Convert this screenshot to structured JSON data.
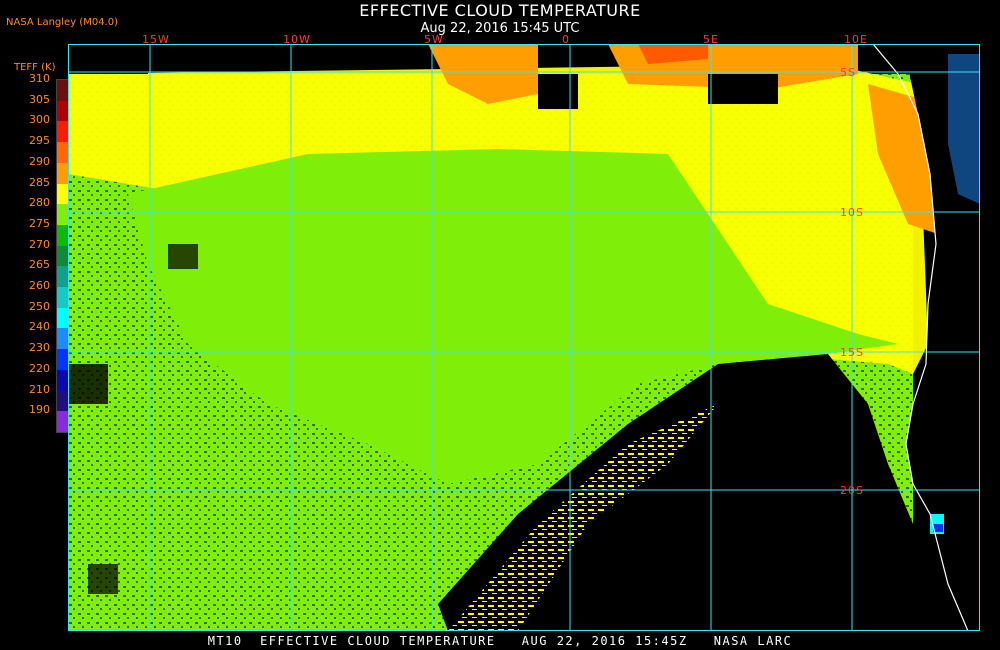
{
  "header": {
    "title": "EFFECTIVE CLOUD TEMPERATURE",
    "timestamp": "Aug 22, 2016 15:45 UTC",
    "producer": "NASA Langley (M04.0)"
  },
  "legend": {
    "title": "TEFF (K)",
    "entries": [
      {
        "value": "310",
        "color": "#6e0f0f"
      },
      {
        "value": "305",
        "color": "#b00000"
      },
      {
        "value": "300",
        "color": "#ff1a00"
      },
      {
        "value": "295",
        "color": "#ff6a00"
      },
      {
        "value": "290",
        "color": "#ff9e00"
      },
      {
        "value": "285",
        "color": "#ffff00"
      },
      {
        "value": "280",
        "color": "#7fef0a"
      },
      {
        "value": "275",
        "color": "#11b510"
      },
      {
        "value": "270",
        "color": "#0e8a3a"
      },
      {
        "value": "265",
        "color": "#12a08a"
      },
      {
        "value": "260",
        "color": "#19c8c0"
      },
      {
        "value": "250",
        "color": "#00ffff"
      },
      {
        "value": "240",
        "color": "#1e8cff"
      },
      {
        "value": "230",
        "color": "#0036ff"
      },
      {
        "value": "220",
        "color": "#0a0aa8"
      },
      {
        "value": "210",
        "color": "#20107a"
      },
      {
        "value": "190",
        "color": "#8a2ad8"
      }
    ]
  },
  "map": {
    "longitude_labels": [
      "15W",
      "10W",
      "5W",
      "0",
      "5E",
      "10E"
    ],
    "latitude_labels": [
      "5S",
      "10S",
      "15S",
      "20S"
    ],
    "gridline_color": "#34e6f0",
    "coastline_color": "#ffffff",
    "no_data_color": "#000000"
  },
  "footer": {
    "text": "MT10  EFFECTIVE CLOUD TEMPERATURE   AUG 22, 2016 15:45Z   NASA LARC"
  }
}
